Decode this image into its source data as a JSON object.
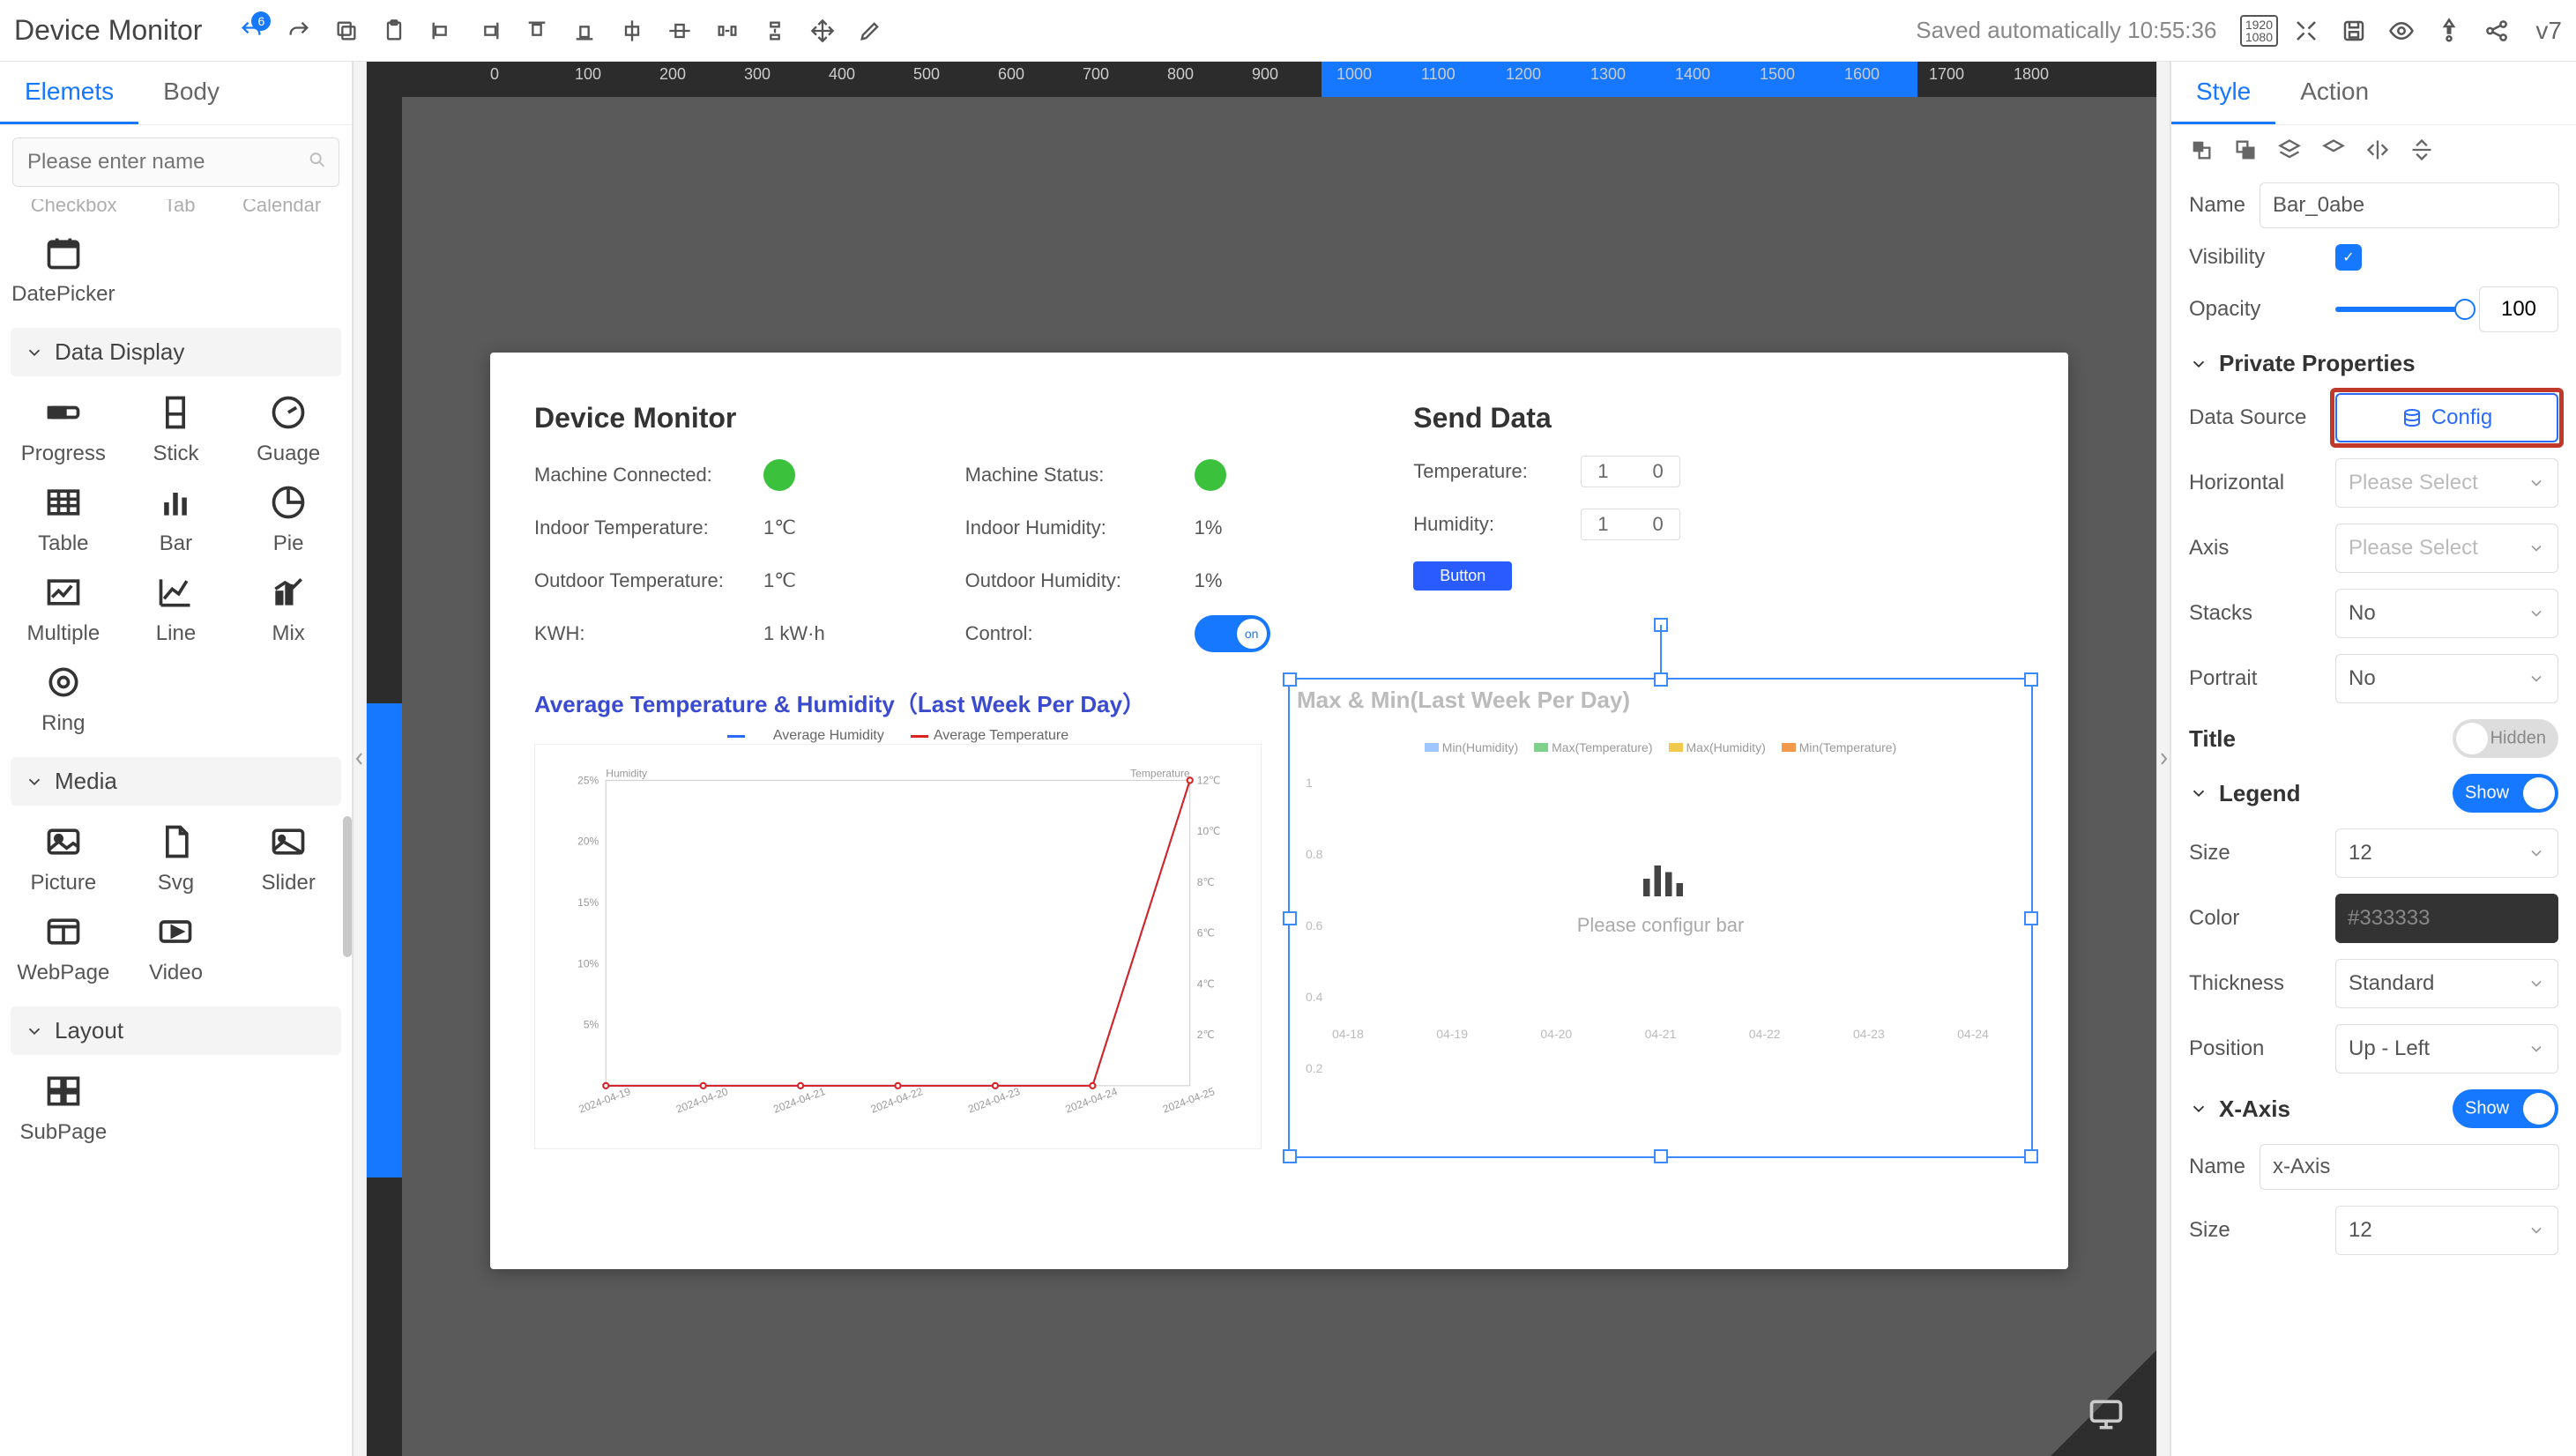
{
  "topbar": {
    "title": "Device Monitor",
    "undo_badge": "6",
    "saved_text": "Saved automatically 10:55:36",
    "resolution": "1920\n1080",
    "version": "v7"
  },
  "left": {
    "tab_elements": "Elemets",
    "tab_body": "Body",
    "search_placeholder": "Please enter name",
    "cutoff": {
      "a": "Checkbox",
      "b": "Tab",
      "c": "Calendar"
    },
    "items": {
      "datepicker": "DatePicker",
      "progress": "Progress",
      "stick": "Stick",
      "guage": "Guage",
      "table": "Table",
      "bar": "Bar",
      "pie": "Pie",
      "multiple": "Multiple",
      "line": "Line",
      "mix": "Mix",
      "ring": "Ring",
      "picture": "Picture",
      "svg": "Svg",
      "slider": "Slider",
      "webpage": "WebPage",
      "video": "Video",
      "subpage": "SubPage"
    },
    "groups": {
      "data_display": "Data Display",
      "media": "Media",
      "layout": "Layout"
    }
  },
  "canvas": {
    "hticks": [
      "0",
      "100",
      "200",
      "300",
      "400",
      "500",
      "600",
      "700",
      "800",
      "900",
      "1000",
      "1100",
      "1200",
      "1300",
      "1400",
      "1500",
      "1600",
      "1700",
      "1800"
    ],
    "hsel": {
      "start": 9.4,
      "end": 15.4
    },
    "page": {
      "title_left": "Device Monitor",
      "title_right": "Send Data",
      "rows": {
        "machine_connected": "Machine Connected:",
        "machine_status": "Machine Status:",
        "indoor_temp_k": "Indoor Temperature:",
        "indoor_temp_v": "1℃",
        "indoor_hum_k": "Indoor Humidity:",
        "indoor_hum_v": "1%",
        "outdoor_temp_k": "Outdoor Temperature:",
        "outdoor_temp_v": "1℃",
        "outdoor_hum_k": "Outdoor Humidity:",
        "outdoor_hum_v": "1%",
        "kwh_k": "KWH:",
        "kwh_v": "1 kW·h",
        "control_k": "Control:",
        "switch_label": "on"
      },
      "send": {
        "temp_k": "Temperature:",
        "temp_lo": "1",
        "temp_hi": "0",
        "hum_k": "Humidity:",
        "hum_lo": "1",
        "hum_hi": "0",
        "button": "Button"
      },
      "chart1_title": "Average Temperature & Humidity（Last Week Per Day）",
      "chart1_legend": {
        "a": "Average Humidity",
        "b": "Average Temperature"
      },
      "chart1_ylab_left": "Humidity",
      "chart1_ylab_right": "Temperature",
      "chart2_title": "Max & Min(Last Week Per Day)",
      "chart2_legend": {
        "a": "Min(Humidity)",
        "b": "Max(Temperature)",
        "c": "Max(Humidity)",
        "d": "Min(Temperature)"
      },
      "chart2_placeholder": "Please configur bar"
    }
  },
  "chart_data": [
    {
      "type": "line",
      "title": "Average Temperature & Humidity（Last Week Per Day）",
      "categories": [
        "2024-04-19",
        "2024-04-20",
        "2024-04-21",
        "2024-04-22",
        "2024-04-23",
        "2024-04-24",
        "2024-04-25"
      ],
      "series": [
        {
          "name": "Average Humidity",
          "axis": "left",
          "color": "#2a6bff",
          "values": [
            0,
            0,
            0,
            0,
            0,
            0,
            25
          ]
        },
        {
          "name": "Average Temperature",
          "axis": "right",
          "color": "#d22",
          "values": [
            0,
            0,
            0,
            0,
            0,
            0,
            12
          ]
        }
      ],
      "ylabel_left": "Humidity",
      "ylim_left": [
        0,
        25
      ],
      "yticks_left": [
        "25%",
        "20%",
        "15%",
        "10%",
        "5%"
      ],
      "ylabel_right": "Temperature",
      "ylim_right": [
        0,
        12
      ],
      "yticks_right": [
        "12℃",
        "10℃",
        "8℃",
        "6℃",
        "4℃",
        "2℃"
      ]
    },
    {
      "type": "bar",
      "title": "Max & Min(Last Week Per Day)",
      "categories": [
        "04-18",
        "04-19",
        "04-20",
        "04-21",
        "04-22",
        "04-23",
        "04-24"
      ],
      "series": [
        {
          "name": "Min(Humidity)",
          "color": "#9ec7ff",
          "values": []
        },
        {
          "name": "Max(Temperature)",
          "color": "#7fd08a",
          "values": []
        },
        {
          "name": "Max(Humidity)",
          "color": "#f2c94c",
          "values": []
        },
        {
          "name": "Min(Temperature)",
          "color": "#f2994a",
          "values": []
        }
      ],
      "ylim": [
        0,
        1
      ],
      "yticks": [
        "1",
        "0.8",
        "0.6",
        "0.4",
        "0.2"
      ],
      "note": "Please configur bar"
    }
  ],
  "right": {
    "tab_style": "Style",
    "tab_action": "Action",
    "name_label": "Name",
    "name_value": "Bar_0abe",
    "visibility_label": "Visibility",
    "opacity_label": "Opacity",
    "opacity_value": "100",
    "private_head": "Private Properties",
    "datasource_label": "Data Source",
    "config_label": "Config",
    "horizontal_label": "Horizontal",
    "horizontal_placeholder": "Please Select",
    "axis_label": "Axis",
    "axis_placeholder": "Please Select",
    "stacks_label": "Stacks",
    "stacks_value": "No",
    "portrait_label": "Portrait",
    "portrait_value": "No",
    "title_head": "Title",
    "title_toggle": "Hidden",
    "legend_head": "Legend",
    "legend_toggle": "Show",
    "size_label": "Size",
    "size_value": "12",
    "color_label": "Color",
    "color_value": "#333333",
    "thickness_label": "Thickness",
    "thickness_value": "Standard",
    "position_label": "Position",
    "position_value": "Up - Left",
    "xaxis_head": "X-Axis",
    "xaxis_toggle": "Show",
    "xaxis_name_label": "Name",
    "xaxis_name_value": "x-Axis",
    "xaxis_size_label": "Size",
    "xaxis_size_value": "12"
  }
}
